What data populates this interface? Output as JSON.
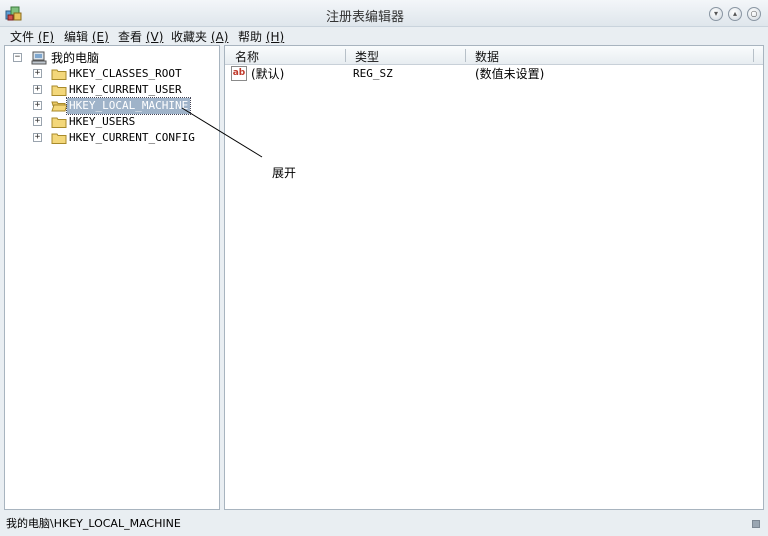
{
  "window": {
    "title": "注册表编辑器"
  },
  "menu": [
    {
      "label": "文件",
      "accel": "(F)"
    },
    {
      "label": "编辑",
      "accel": "(E)"
    },
    {
      "label": "查看",
      "accel": "(V)"
    },
    {
      "label": "收藏夹",
      "accel": "(A)"
    },
    {
      "label": "帮助",
      "accel": "(H)"
    }
  ],
  "tree": {
    "root": {
      "label": "我的电脑",
      "expander": "−"
    },
    "items": [
      {
        "label": "HKEY_CLASSES_ROOT",
        "expander": "+"
      },
      {
        "label": "HKEY_CURRENT_USER",
        "expander": "+"
      },
      {
        "label": "HKEY_LOCAL_MACHINE",
        "expander": "+"
      },
      {
        "label": "HKEY_USERS",
        "expander": "+"
      },
      {
        "label": "HKEY_CURRENT_CONFIG",
        "expander": "+"
      }
    ]
  },
  "list": {
    "columns": [
      "名称",
      "类型",
      "数据"
    ],
    "rows": [
      {
        "icon": "ab",
        "name": "(默认)",
        "type": "REG_SZ",
        "data": "(数值未设置)"
      }
    ]
  },
  "annotation": {
    "text": "展开"
  },
  "status": {
    "path": "我的电脑\\HKEY_LOCAL_MACHINE"
  },
  "colors": {
    "selection": "#9fb3c9",
    "folder": "#f3d77a",
    "window_bg": "#e9eef2"
  }
}
